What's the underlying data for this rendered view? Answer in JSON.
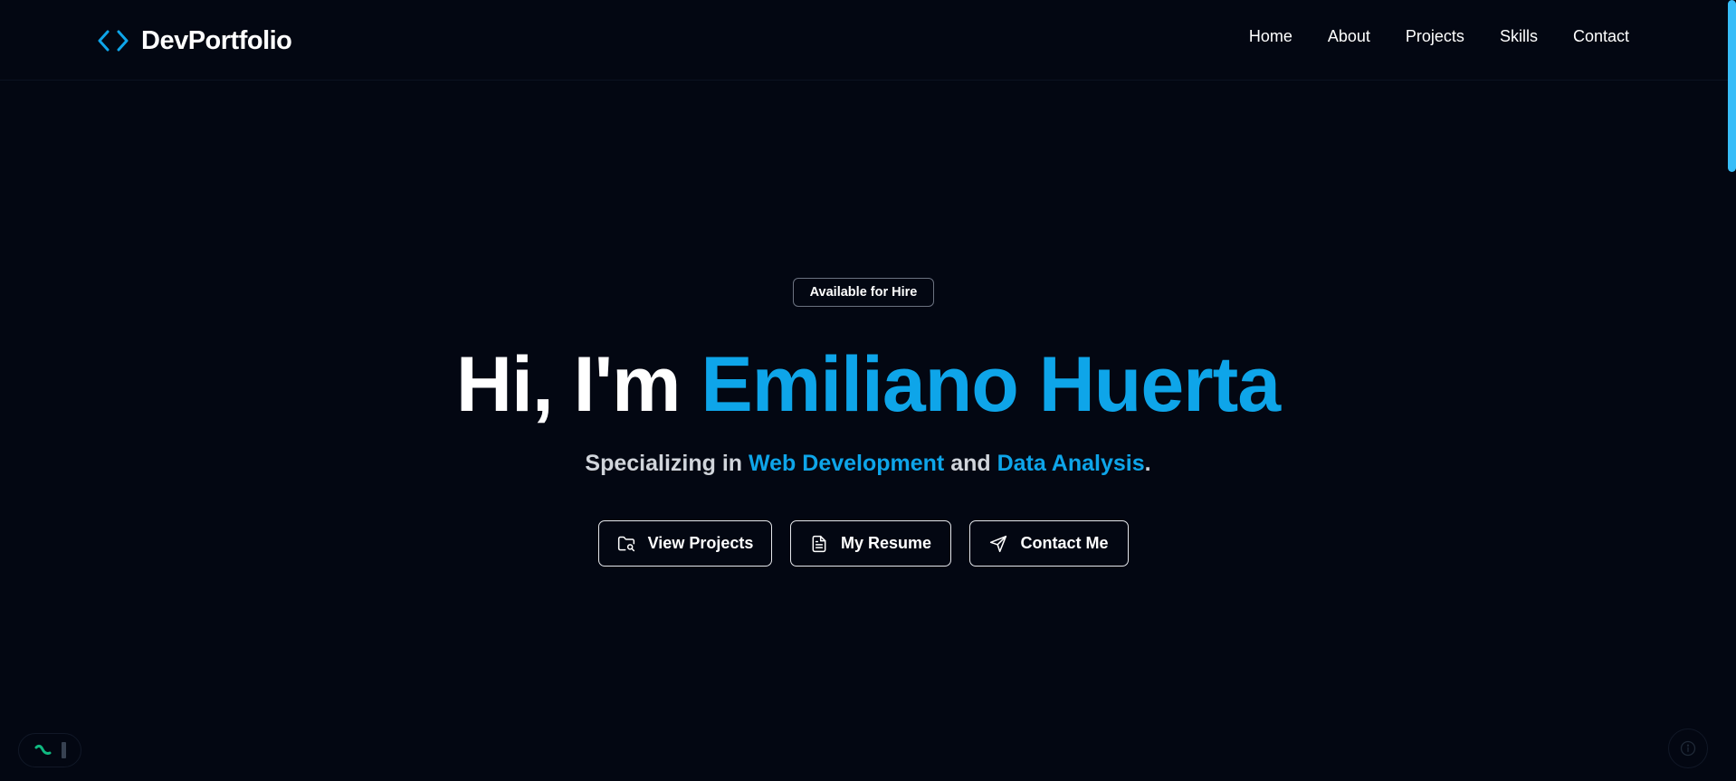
{
  "brand": {
    "name": "DevPortfolio",
    "icon": "code-brackets-icon",
    "accent": "#0ea5e9"
  },
  "nav": {
    "items": [
      {
        "label": "Home"
      },
      {
        "label": "About"
      },
      {
        "label": "Projects"
      },
      {
        "label": "Skills"
      },
      {
        "label": "Contact"
      }
    ]
  },
  "hero": {
    "badge": "Available for Hire",
    "headline_lead": "Hi, I'm ",
    "headline_name": "Emiliano Huerta",
    "subtitle_prefix": "Specializing in ",
    "subtitle_skill_1": "Web Development",
    "subtitle_mid": " and ",
    "subtitle_skill_2": "Data Analysis",
    "subtitle_suffix": "."
  },
  "actions": {
    "view_projects": {
      "label": "View Projects",
      "icon": "folder-search-icon"
    },
    "resume": {
      "label": "My Resume",
      "icon": "file-text-icon"
    },
    "contact": {
      "label": "Contact Me",
      "icon": "send-icon"
    }
  },
  "colors": {
    "background": "#030712",
    "accent": "#0ea5e9",
    "text": "#ffffff",
    "muted": "#d1d5db"
  }
}
